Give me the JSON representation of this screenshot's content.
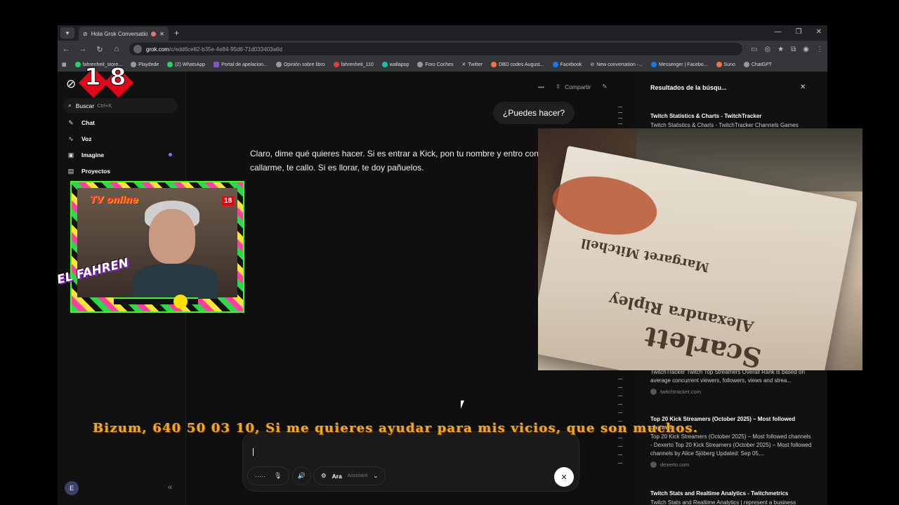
{
  "browser": {
    "tab_title": "Hola Grok Conversation - G",
    "url_host": "grok.com",
    "url_path": "/c/edd6ce82-b35e-4e84-95d6-71d033403a6d",
    "bookmarks": [
      "fahrenheit_store...",
      "Playdede",
      "(2) WhatsApp",
      "Portal de apelacion...",
      "Opinión sobre libro",
      "fahrenheit_110",
      "wallapop",
      "Foro Coches",
      "Twitter",
      "DBD codes August...",
      "Facebook",
      "New conversation -...",
      "Messenger | Facebo...",
      "Suno",
      "ChatGPT"
    ]
  },
  "sidebar": {
    "search_label": "Buscar",
    "search_shortcut": "Ctrl+K",
    "items": [
      {
        "label": "Chat",
        "icon": "chat-edit-icon"
      },
      {
        "label": "Voz",
        "icon": "waveform-icon"
      },
      {
        "label": "Imagine",
        "icon": "image-icon"
      },
      {
        "label": "Proyectos",
        "icon": "folder-icon"
      }
    ],
    "avatar_letter": "E",
    "accent_color": "#7c7cf0"
  },
  "chat": {
    "share_label": "Compartir",
    "user_message": "¿Puedes hacer?",
    "assistant_message": "Claro, dime qué quieres hacer. Si es entrar a Kick, pon tu nombre y entro contigo. Si es callarme, te callo. Si es llorar, te doy pañuelos.",
    "composer": {
      "voice_name": "Ara",
      "voice_role": "Assistant"
    }
  },
  "results_panel": {
    "title": "Resultados de la búsqu...",
    "results": [
      {
        "title": "Twitch Statistics & Charts - TwitchTracker",
        "snippet": "Twitch Statistics & Charts - TwitchTracker Channels Games",
        "source": ""
      },
      {
        "title": "",
        "snippet": "TwitchTracker Twitch Top Streamers Overall Rank is based on average concurrent viewers, followers, views and strea...",
        "source": "twitchtracker.com"
      },
      {
        "title": "Top 20 Kick Streamers (October 2025) – Most followed channels",
        "snippet": "Top 20 Kick Streamers (October 2025) – Most followed channels - Dexerto Top 20 Kick Streamers (October 2025) – Most followed channels by Alice Sjöberg Updated: Sep 05,...",
        "source": "dexerto.com"
      },
      {
        "title": "Twitch Stats and Realtime Analytics - Twitchmetrics",
        "snippet": "Twitch Stats and Realtime Analytics | represent a business",
        "source": ""
      }
    ]
  },
  "overlay": {
    "badge_digits": [
      "1",
      "8"
    ],
    "tv_label": "TV online",
    "fahren_label": "EL FAHREN",
    "ticker": "Bizum, 640 50 03 10, Si me quieres ayudar para mis vicios, que son muchos.",
    "book_lines": [
      "Alexandra Ripley",
      "Scarlett",
      "Margaret Mitchell"
    ]
  }
}
